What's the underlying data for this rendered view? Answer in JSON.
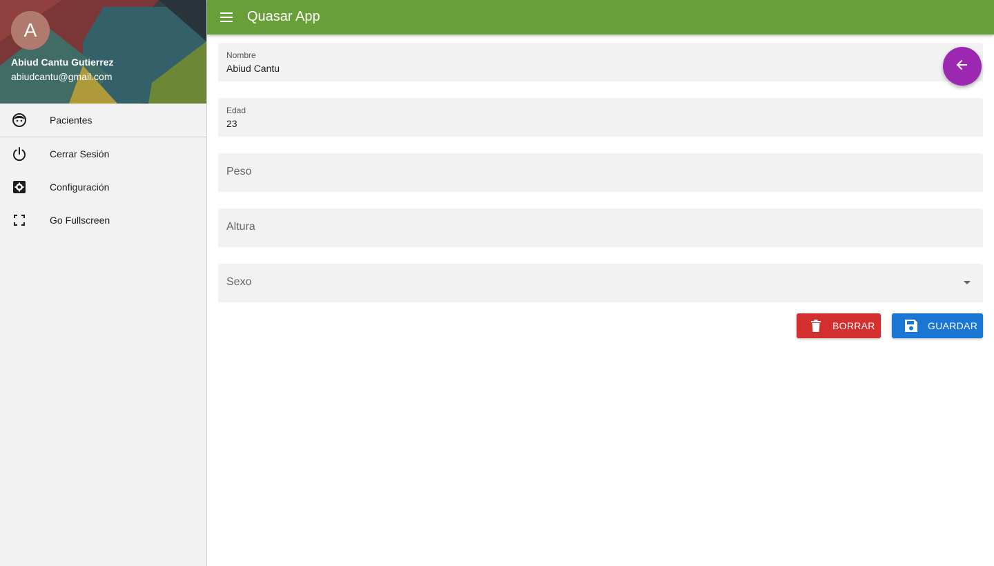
{
  "header": {
    "title": "Quasar App",
    "color": "#689f38"
  },
  "drawer": {
    "profile": {
      "avatar_letter": "A",
      "name": "Abiud Cantu Gutierrez",
      "email": "abiudcantu@gmail.com"
    },
    "items": [
      {
        "label": "Pacientes",
        "icon": "face-icon"
      },
      {
        "label": "Cerrar Sesión",
        "icon": "power-icon"
      },
      {
        "label": "Configuración",
        "icon": "settings-icon"
      },
      {
        "label": "Go Fullscreen",
        "icon": "fullscreen-icon"
      }
    ]
  },
  "form": {
    "nombre": {
      "label": "Nombre",
      "value": "Abiud Cantu"
    },
    "edad": {
      "label": "Edad",
      "value": "23"
    },
    "peso": {
      "label": "Peso",
      "value": ""
    },
    "altura": {
      "label": "Altura",
      "value": ""
    },
    "sexo": {
      "label": "Sexo",
      "value": ""
    }
  },
  "fab": {
    "icon": "arrow-back-icon",
    "color": "#9c27b0"
  },
  "actions": {
    "delete_label": "BORRAR",
    "delete_color": "#d32f2f",
    "save_label": "GUARDAR",
    "save_color": "#1976d2"
  }
}
